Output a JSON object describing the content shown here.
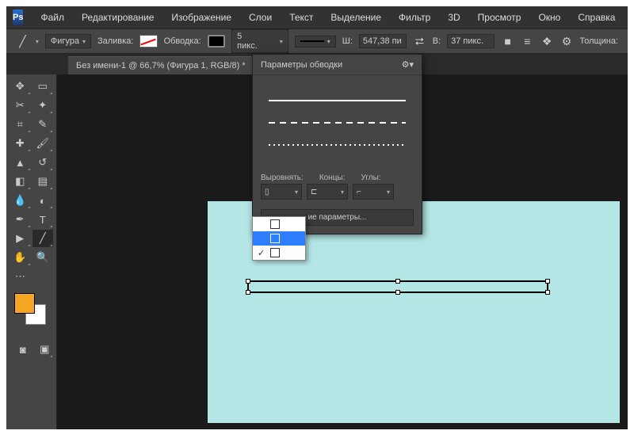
{
  "menu": {
    "items": [
      "Файл",
      "Редактирование",
      "Изображение",
      "Слои",
      "Текст",
      "Выделение",
      "Фильтр",
      "3D",
      "Просмотр",
      "Окно",
      "Справка"
    ]
  },
  "options": {
    "mode_label": "Фигура",
    "fill_label": "Заливка:",
    "stroke_label": "Обводка:",
    "stroke_width": "5 пикс.",
    "w_label": "Ш:",
    "w_value": "547,38 пи",
    "link_icon": "⮂",
    "h_label": "В:",
    "h_value": "37 пикс.",
    "thickness_label": "Толщина:"
  },
  "tab": {
    "title": "Без имени-1 @ 66,7% (Фигура 1, RGB/8) *"
  },
  "stroke_panel": {
    "title": "Параметры обводки",
    "labels": {
      "align": "Выровнять:",
      "caps": "Концы:",
      "corners": "Углы:"
    },
    "more": "ие параметры..."
  },
  "align_dropdown": {
    "options": [
      {
        "checked": false,
        "selected": false
      },
      {
        "checked": false,
        "selected": true
      },
      {
        "checked": true,
        "selected": false
      }
    ]
  },
  "colors": {
    "canvas": "#b5e6e6",
    "fg_swatch": "#f5a623"
  }
}
